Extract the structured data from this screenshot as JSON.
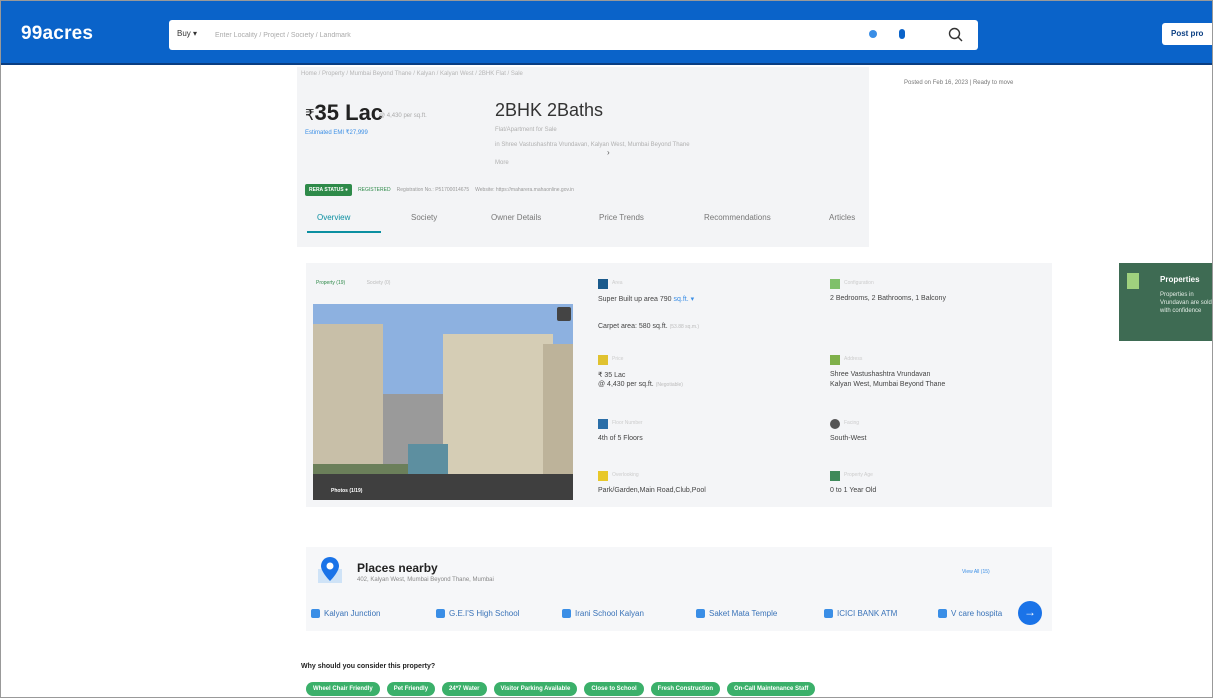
{
  "header": {
    "logo": "99acres",
    "buy_label": "Buy",
    "search_placeholder": "Enter Locality / Project / Society / Landmark",
    "post_label": "Post pro"
  },
  "breadcrumb": "Home / Property / Mumbai Beyond Thane / Kalyan / Kalyan West / 2BHK Flat / Sale",
  "posted": "Posted on Feb 16, 2023  |  Ready to move",
  "price": {
    "currency": "₹",
    "amount": "35 Lac",
    "per_sqft": "@ 4,430 per sq.ft.",
    "emi": "Estimated EMI ₹27,999"
  },
  "title": {
    "bhk": "2BHK 2Baths",
    "type": "Flat/Apartment for Sale",
    "address": "in Shree Vastushashtra Vrundavan, Kalyan West, Mumbai Beyond Thane",
    "more": "More"
  },
  "rera": {
    "badge": "RERA STATUS",
    "registered": "REGISTERED",
    "reg_no": "Registration No.: P51700014675",
    "website": "Website: https://maharera.mahaonline.gov.in"
  },
  "tabs": [
    "Overview",
    "Society",
    "Owner Details",
    "Price Trends",
    "Recommendations",
    "Articles"
  ],
  "tab_arrow": "›",
  "media": {
    "tab_property": "Property (19)",
    "tab_society": "Society (0)",
    "photos_label": "Photos (1/19)"
  },
  "features": {
    "area": {
      "sub": "Area",
      "line1": "Super Built up area 790",
      "unit": "sq.ft.",
      "line2": "Carpet area: 580 sq.ft.",
      "line2_muted": "(53.88 sq.m.)"
    },
    "config": {
      "sub": "Configuration",
      "line1": "2 Bedrooms, 2 Bathrooms, 1 Balcony"
    },
    "price": {
      "sub": "Price",
      "line1": "₹ 35 Lac",
      "line2": "@ 4,430 per sq.ft.",
      "line2_muted": "(Negotiable)"
    },
    "address": {
      "sub": "Address",
      "line1": "Shree Vastushashtra Vrundavan",
      "line2": "Kalyan West, Mumbai Beyond Thane"
    },
    "floor": {
      "sub": "Floor Number",
      "line1": "4th of 5 Floors"
    },
    "facing": {
      "sub": "Facing",
      "line1": "South-West"
    },
    "overlooking": {
      "sub": "Overlooking",
      "line1": "Park/Garden,Main Road,Club,Pool"
    },
    "age": {
      "sub": "Property Age",
      "line1": "0 to 1 Year Old"
    }
  },
  "promo": {
    "title": "Properties",
    "text": "Properties in Vrundavan are sold with confidence"
  },
  "places": {
    "title": "Places nearby",
    "subtitle": "402, Kalyan West, Mumbai Beyond Thane, Mumbai",
    "view_all": "View All (15)",
    "items": [
      "Kalyan Junction",
      "G.E.I'S High School",
      "Irani School Kalyan",
      "Saket Mata Temple",
      "ICICI BANK ATM",
      "V care hospita"
    ],
    "scroll_arrow": "→"
  },
  "why": {
    "title": "Why should you consider this property?",
    "chips": [
      "Wheel Chair Friendly",
      "Pet Friendly",
      "24*7 Water",
      "Visitor Parking Available",
      "Close to School",
      "Fresh Construction",
      "On-Call Maintenance Staff"
    ]
  },
  "colors": {
    "brand": "#0a63c9",
    "accent": "#0b8fa1",
    "rera_green": "#2e8a49",
    "chip_green": "#3bb06a"
  }
}
